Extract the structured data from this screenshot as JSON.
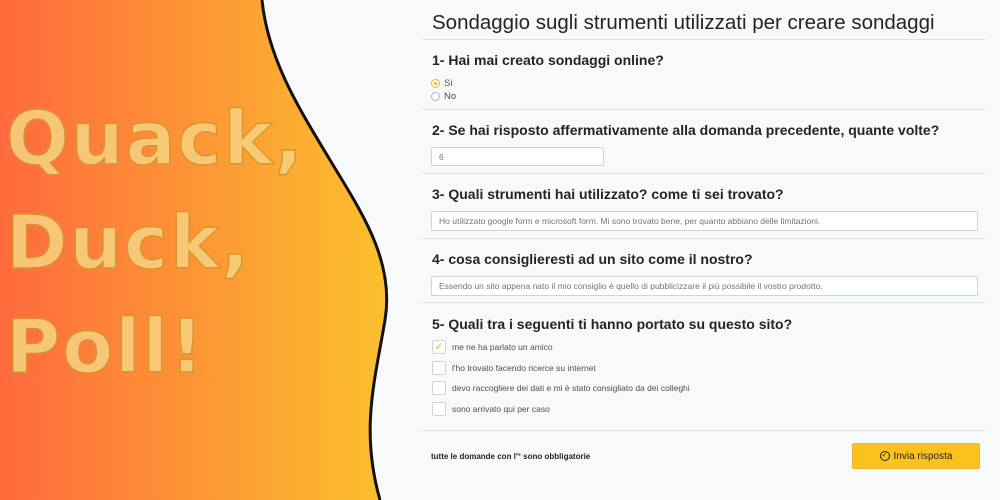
{
  "brand": {
    "lines": [
      "Quack,",
      "Duck,",
      "Poll!"
    ],
    "colors": {
      "orange": "#ff6a3d",
      "yellow": "#fbc02d"
    }
  },
  "survey": {
    "title": "Sondaggio sugli strumenti utilizzati per creare sondaggi",
    "q1": {
      "label": "1- Hai mai creato sondaggi online?",
      "options": [
        {
          "label": "Si",
          "checked": true
        },
        {
          "label": "No",
          "checked": false
        }
      ]
    },
    "q2": {
      "label": "2- Se hai risposto affermativamente alla domanda precedente, quante volte?",
      "value": "6"
    },
    "q3": {
      "label": "3- Quali strumenti hai utilizzato? come ti sei trovato?",
      "value": "Ho utilizzato google form e microsoft form. Mi sono trovato bene, per quanto abbiano delle limitazioni."
    },
    "q4": {
      "label": "4- cosa consiglieresti ad un sito come il nostro?",
      "value": "Essendo un sito appena nato il mio consiglio è quello di pubblicizzare il più possibile il vostro prodotto."
    },
    "q5": {
      "label": "5- Quali tra i seguenti ti hanno portato su questo sito?",
      "options": [
        {
          "label": "me ne ha parlato un amico",
          "checked": true
        },
        {
          "label": "l'ho trovato facendo ricerce su internet",
          "checked": false
        },
        {
          "label": "devo raccogliere dei dati e mi è stato consigliato da dei colleghi",
          "checked": false
        },
        {
          "label": "sono arrivato qui per caso",
          "checked": false
        }
      ]
    },
    "footer": {
      "note_prefix": "tutte le domande con l'",
      "note_star": "*",
      "note_suffix": " sono obbligatorie",
      "submit_label": "Invia risposta",
      "submit_icon": "check-circle-icon"
    }
  }
}
